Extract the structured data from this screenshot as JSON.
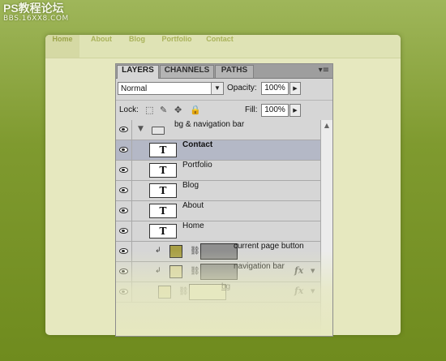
{
  "watermark": {
    "title": "PS教程论坛",
    "url": "BBS.16XX8.COM"
  },
  "site_nav": {
    "items": [
      {
        "label": "Home",
        "active": true
      },
      {
        "label": "About",
        "active": false
      },
      {
        "label": "Blog",
        "active": false
      },
      {
        "label": "Portfolio",
        "active": false
      },
      {
        "label": "Contact",
        "active": false
      }
    ]
  },
  "panel": {
    "tabs": [
      "LAYERS",
      "CHANNELS",
      "PATHS"
    ],
    "active_tab": "LAYERS",
    "menu_icon": "▾≡",
    "blend_mode": "Normal",
    "opacity_label": "Opacity:",
    "opacity_value": "100%",
    "lock_label": "Lock:",
    "fill_label": "Fill:",
    "fill_value": "100%",
    "layers": [
      {
        "name": "bg & navigation bar",
        "kind": "group"
      },
      {
        "name": "Contact",
        "kind": "text",
        "selected": true
      },
      {
        "name": "Portfolio",
        "kind": "text"
      },
      {
        "name": "Blog",
        "kind": "text"
      },
      {
        "name": "About",
        "kind": "text"
      },
      {
        "name": "Home",
        "kind": "text"
      },
      {
        "name": "current page button",
        "kind": "shape",
        "swatch": "#a89f45"
      },
      {
        "name": "navigation bar",
        "kind": "shape",
        "swatch": "#d8d3a0",
        "fx": "fx"
      },
      {
        "name": "bg",
        "kind": "shape",
        "swatch": "#ddd9a6",
        "fx": "fx"
      }
    ]
  },
  "colors": {
    "page_bg": "#7f9a2f",
    "site_panel": "#e6e8bf",
    "nav_text": "#a9b25a",
    "selected_row": "#b4b8c6"
  }
}
